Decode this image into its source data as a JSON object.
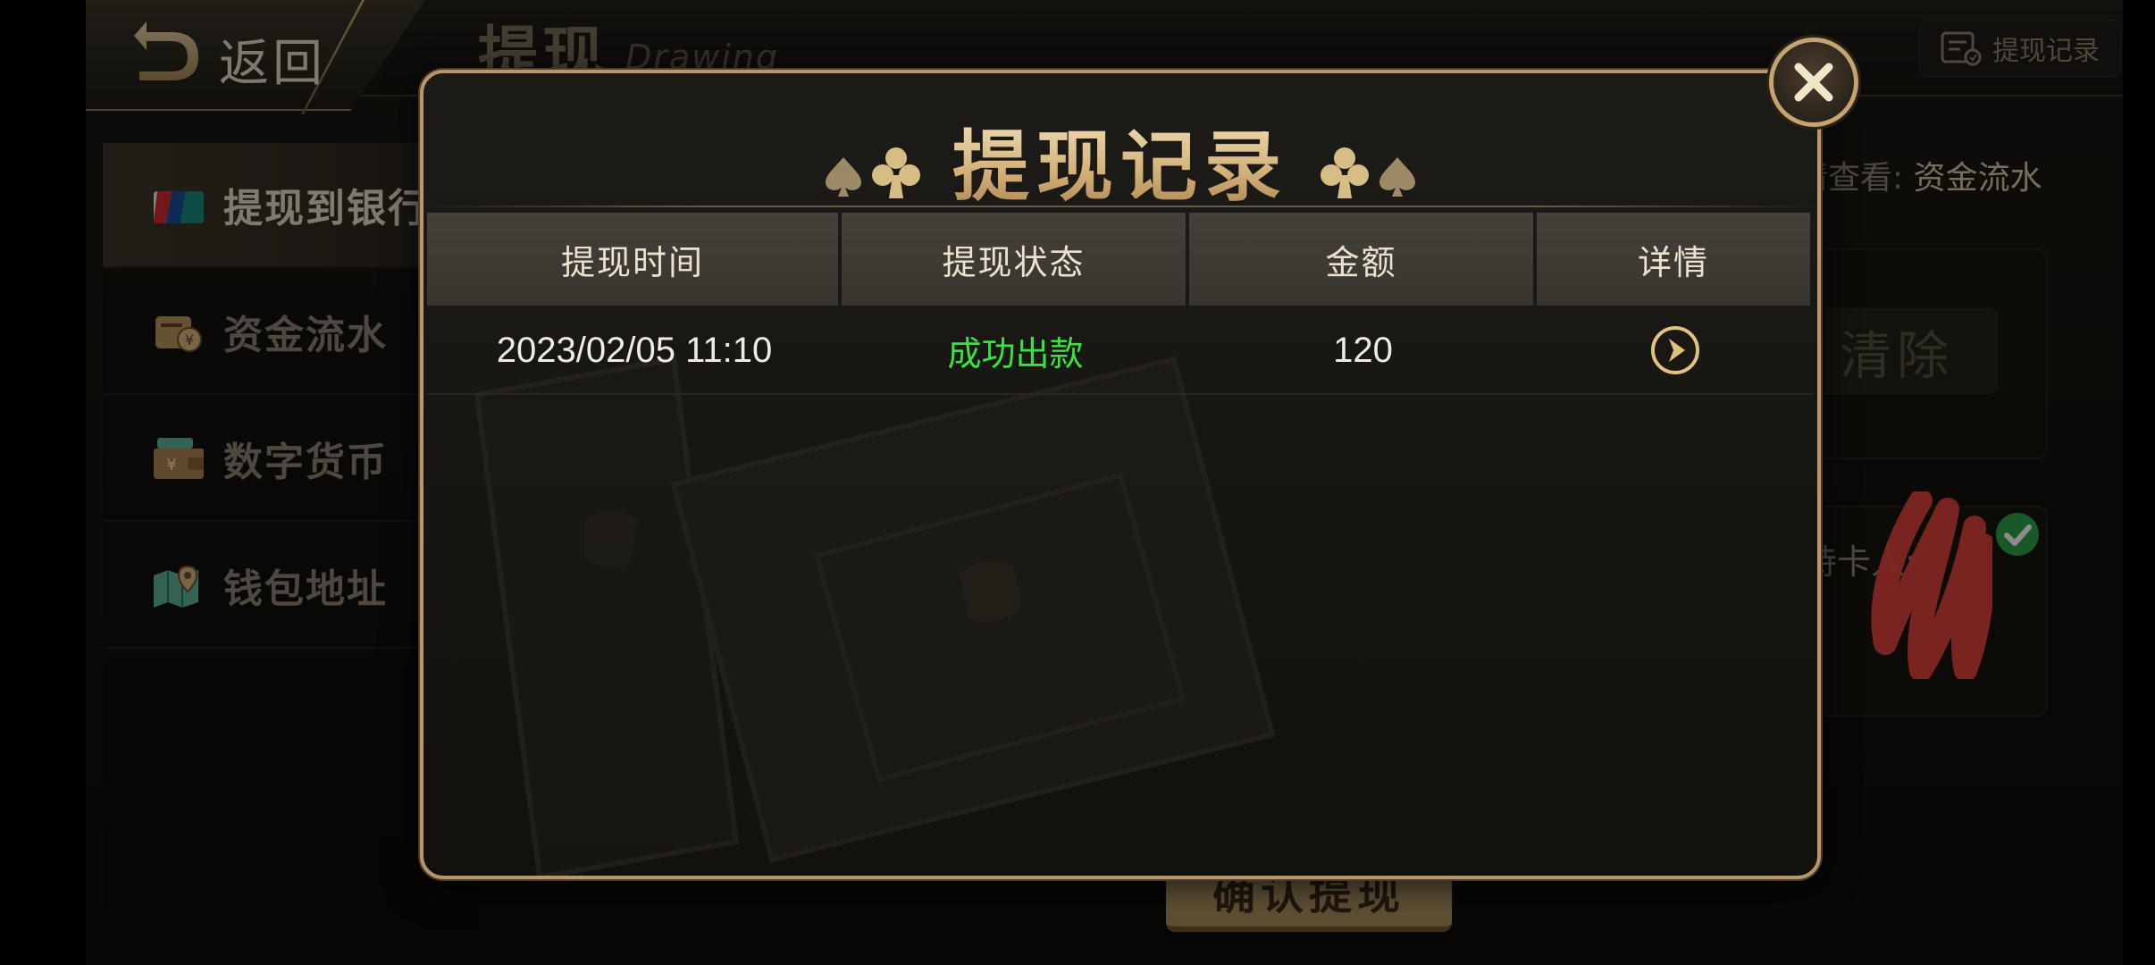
{
  "header": {
    "back_label": "返回",
    "page_title": "提现",
    "page_title_en": "Drawing",
    "record_button_label": "提现记录"
  },
  "sidebar": {
    "items": [
      {
        "label": "提现到银行",
        "icon": "unionpay-card-icon",
        "active": true
      },
      {
        "label": "资金流水",
        "icon": "wallet-yen-icon",
        "active": false
      },
      {
        "label": "数字货币",
        "icon": "purse-yen-icon",
        "active": false
      },
      {
        "label": "钱包地址",
        "icon": "map-location-icon",
        "active": false
      }
    ]
  },
  "main": {
    "hint_prefix": "请查看:",
    "hint_link": "资金流水",
    "clear_label": "清除",
    "cardholder_label": "持卡人:",
    "confirm_label": "确认提现"
  },
  "modal": {
    "title": "提现记录",
    "columns": [
      "提现时间",
      "提现状态",
      "金额",
      "详情"
    ],
    "rows": [
      {
        "time": "2023/02/05 11:10",
        "status": "成功出款",
        "amount": "120",
        "detail_icon": "arrow-right-circle-icon"
      }
    ]
  },
  "colors": {
    "gold": "#c9a971",
    "success_green": "#3ce23f",
    "header_cell": "#3e3a34",
    "redaction": "#e8453f"
  }
}
